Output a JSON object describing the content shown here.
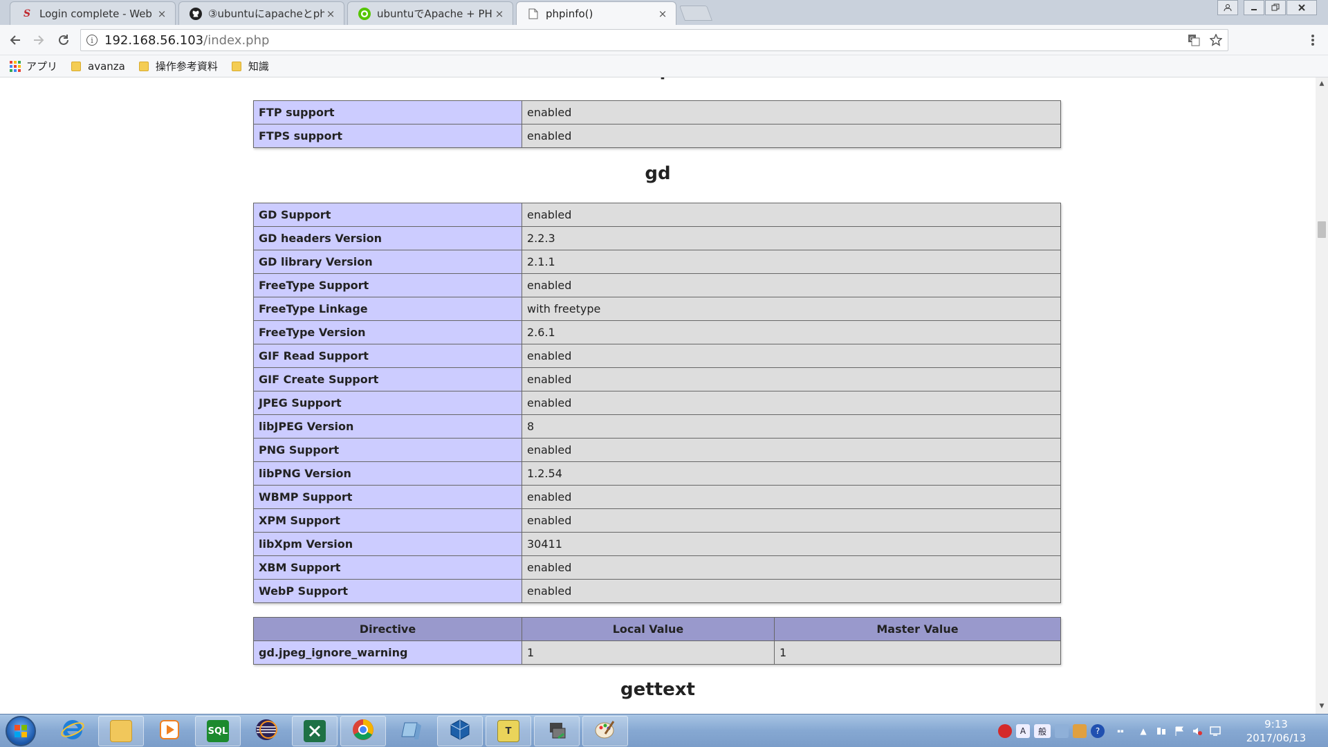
{
  "browser": {
    "tabs": [
      {
        "title": "Login complete - Web",
        "favicon": "shibboleth-icon",
        "active": false
      },
      {
        "title": "③ubuntuにapacheとph",
        "favicon": "github-icon",
        "active": false
      },
      {
        "title": "ubuntuでApache + PH",
        "favicon": "qiita-icon",
        "active": false
      },
      {
        "title": "phpinfo()",
        "favicon": "page-icon",
        "active": true
      }
    ],
    "close_glyph": "×",
    "address": {
      "host": "192.168.56.103",
      "path": "/index.php"
    },
    "bookmarks": [
      "アプリ",
      "avanza",
      "操作参考資料",
      "知識"
    ]
  },
  "page": {
    "partial_heading": "ftp",
    "ftp_rows": [
      {
        "name": "FTP support",
        "value": "enabled"
      },
      {
        "name": "FTPS support",
        "value": "enabled"
      }
    ],
    "gd_heading": "gd",
    "gd_rows": [
      {
        "name": "GD Support",
        "value": "enabled"
      },
      {
        "name": "GD headers Version",
        "value": "2.2.3"
      },
      {
        "name": "GD library Version",
        "value": "2.1.1"
      },
      {
        "name": "FreeType Support",
        "value": "enabled"
      },
      {
        "name": "FreeType Linkage",
        "value": "with freetype"
      },
      {
        "name": "FreeType Version",
        "value": "2.6.1"
      },
      {
        "name": "GIF Read Support",
        "value": "enabled"
      },
      {
        "name": "GIF Create Support",
        "value": "enabled"
      },
      {
        "name": "JPEG Support",
        "value": "enabled"
      },
      {
        "name": "libJPEG Version",
        "value": "8"
      },
      {
        "name": "PNG Support",
        "value": "enabled"
      },
      {
        "name": "libPNG Version",
        "value": "1.2.54"
      },
      {
        "name": "WBMP Support",
        "value": "enabled"
      },
      {
        "name": "XPM Support",
        "value": "enabled"
      },
      {
        "name": "libXpm Version",
        "value": "30411"
      },
      {
        "name": "XBM Support",
        "value": "enabled"
      },
      {
        "name": "WebP Support",
        "value": "enabled"
      }
    ],
    "directive_headers": [
      "Directive",
      "Local Value",
      "Master Value"
    ],
    "directive_rows": [
      {
        "directive": "gd.jpeg_ignore_warning",
        "local": "1",
        "master": "1"
      }
    ],
    "gettext_heading": "gettext"
  },
  "scrollbar": {
    "position_fraction": 0.22
  },
  "taskbar": {
    "apps": [
      "internet-explorer-icon",
      "file-explorer-icon",
      "media-player-icon",
      "sql-developer-icon",
      "eclipse-icon",
      "excel-icon",
      "chrome-icon",
      "notepad-icon",
      "virtualbox-icon",
      "teraterm-icon",
      "network-drive-icon",
      "paint-icon"
    ],
    "sql_label": "SQL",
    "clock_time": "9:13",
    "clock_date": "2017/06/13"
  },
  "colors": {
    "entry_bg": "#ccccff",
    "value_bg": "#dddddd",
    "header_bg": "#9999cc"
  }
}
